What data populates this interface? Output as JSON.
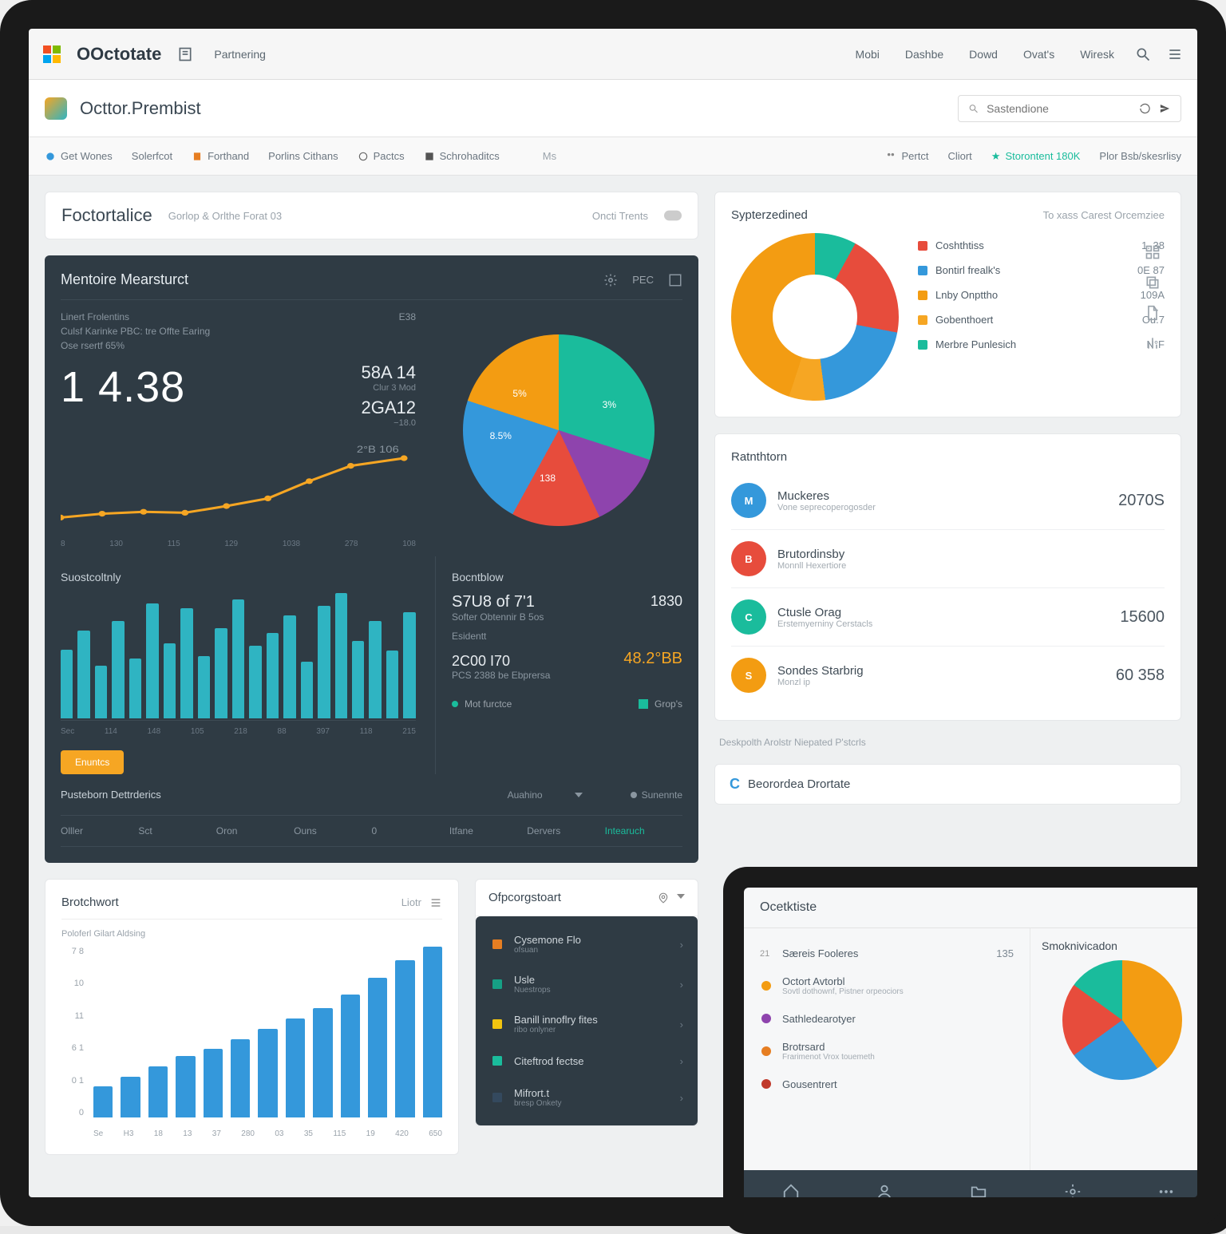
{
  "topbar": {
    "brand": "OOctotate",
    "tab1": "Partnering",
    "nav": [
      "Mobi",
      "Dashbe",
      "Dowd",
      "Ovat's",
      "Wiresk"
    ]
  },
  "subbar": {
    "title": "Octtor.Prembist",
    "search_placeholder": "Sastendione"
  },
  "toolbar": {
    "items": [
      "Get Wones",
      "Solerfcot",
      "Forthand",
      "Porlins Cithans",
      "Pactcs",
      "Schrohaditcs"
    ],
    "right": [
      "Pertct",
      "Cliort",
      "Storontent 180K",
      "Plor Bsb/skesrlisy"
    ]
  },
  "page": {
    "title": "Foctortalice",
    "subtitle": "Gorlop & Orlthe Forat 03",
    "link": "Oncti Trents"
  },
  "dark": {
    "title": "Mentoire Mearsturct",
    "tab_pec": "PEC",
    "sub1": "Linert Frolentins",
    "sub2": "Culsf Karinke PBC: tre Offte Earing",
    "sub3": "Ose rsertf 65%",
    "big": "1 4.38",
    "right_top_val": "E38",
    "stat1_v": "58A 14",
    "stat1_l": "Clur 3 Mod",
    "stat2_v": "2GA12",
    "stat2_l": "−18.0",
    "spark_x": [
      "8",
      "130",
      "115",
      "129",
      "1038",
      "278",
      "108"
    ],
    "spark_peak": "2°B 106",
    "section2": "Suostcoltnly",
    "bar_x": [
      "Sec",
      "114",
      "148",
      "105",
      "218",
      "88",
      "397",
      "118",
      "215"
    ],
    "col2_title": "Bocntblow",
    "col2_v1": "S7U8 of 7'1",
    "col2_v1s": "Softer Obtennir B 5os",
    "col2_v2": "Esidentt",
    "col2_v3": "2C00 I70",
    "col2_v3s": "PCS 2388 be Ebprersa",
    "col2_side_v": "1830",
    "col2_side_b": "48.2°BB",
    "pill": "Enuntcs",
    "legend1": "Mot furctce",
    "legend2": "Grop's",
    "tbl_title": "Pusteborn Dettrderics",
    "tbl_col2": "Auahino",
    "tbl_col3": "Sunennte",
    "tbl_cells": [
      "Olller",
      "Sct",
      "Oron",
      "Ouns",
      "0",
      "Itfane",
      "Dervers",
      "Intearuch"
    ]
  },
  "donut_card": {
    "title": "Sypterzedined",
    "right_title": "To xass Carest Orcemziee",
    "items": [
      {
        "label": "Coshthtiss",
        "val": "1. 38",
        "color": "#e74c3c"
      },
      {
        "label": "Bontirl frealk's",
        "val": "0E 87",
        "color": "#3498db"
      },
      {
        "label": "Lnby Onpttho",
        "val": "109A",
        "color": "#f39c12"
      },
      {
        "label": "Gobenthoert",
        "val": "Ou.7",
        "color": "#f6a623"
      },
      {
        "label": "Merbre Punlesich",
        "val": "N°F",
        "color": "#1abc9c"
      }
    ]
  },
  "stats": {
    "title": "Ratnthtorn",
    "items": [
      {
        "icon": "M",
        "label": "Muckeres",
        "sub": "Vone seprecoperogosder",
        "val": "2070S",
        "color": "#3498db"
      },
      {
        "icon": "B",
        "label": "Brutordinsby",
        "sub": "Monnll Hexertiore",
        "val": "",
        "color": "#e74c3c"
      },
      {
        "icon": "C",
        "label": "Ctusle Orag",
        "sub": "Erstemyerniny Cerstacls",
        "val": "15600",
        "color": "#1abc9c"
      },
      {
        "icon": "S",
        "label": "Sondes Starbrig",
        "sub": "Monzl ip",
        "val": "60 358",
        "color": "#f39c12"
      }
    ],
    "footer": "Deskpolth Arolstr Niepated P'stcrls"
  },
  "bottom_left": {
    "title": "Brotchwort",
    "tab": "Liotr",
    "sub": "Poloferl Gilart Aldsing",
    "y": [
      "7 8",
      "10",
      "11",
      "6 1",
      "0 1",
      "0"
    ],
    "x": [
      "Se",
      "H3",
      "18",
      "13",
      "37",
      "280",
      "03",
      "35",
      "115",
      "19",
      "420",
      "650"
    ]
  },
  "bottom_mid": {
    "title": "Ofpcorgstoart",
    "items": [
      {
        "label": "Cysemone Flo",
        "sub": "ofsuan",
        "color": "#e67e22"
      },
      {
        "label": "Usle",
        "sub": "Nuestrops",
        "color": "#16a085"
      },
      {
        "label": "Banill innoflry fites",
        "sub": "ribo onlyner",
        "color": "#f1c40f"
      },
      {
        "label": "Citeftrod fectse",
        "sub": "",
        "color": "#1abc9c"
      },
      {
        "label": "Mifrort.t",
        "sub": "bresp Onkety",
        "color": "#34495e"
      }
    ]
  },
  "section_c": {
    "title": "Beorordea Drortate"
  },
  "tablet": {
    "title": "Ocetktiste",
    "col2_title": "Smoknivicadon",
    "items": [
      {
        "label": "Særeis Fooleres",
        "sub": "",
        "val": "135",
        "color": "#d35400"
      },
      {
        "label": "Octort Avtorbl",
        "sub": "Sovtl dothownf, Pistner orpeociors",
        "val": "",
        "color": "#f39c12"
      },
      {
        "label": "Sathledearotyer",
        "sub": "",
        "val": "",
        "color": "#8e44ad"
      },
      {
        "label": "Brotrsard",
        "sub": "Frarimenot Vrox touemeth",
        "val": "",
        "color": "#e67e22"
      },
      {
        "label": "Gousentrert",
        "sub": "",
        "val": "",
        "color": "#c0392b"
      }
    ]
  },
  "chart_data": [
    {
      "type": "line",
      "name": "dark_sparkline",
      "x": [
        "8",
        "130",
        "115",
        "129",
        "1038",
        "278",
        "108"
      ],
      "values": [
        18,
        22,
        24,
        23,
        30,
        38,
        56,
        72,
        80
      ],
      "ylim": [
        0,
        100
      ],
      "color": "#f6a623",
      "peak_label": "2°B 106"
    },
    {
      "type": "pie",
      "name": "dark_pie",
      "slices": [
        {
          "label": "3%",
          "value": 30,
          "color": "#1abc9c"
        },
        {
          "label": "5%",
          "value": 13,
          "color": "#8e44ad"
        },
        {
          "label": "8.5%",
          "value": 15,
          "color": "#e74c3c"
        },
        {
          "label": "138",
          "value": 22,
          "color": "#3498db"
        },
        {
          "label": "",
          "value": 20,
          "color": "#f39c12"
        }
      ]
    },
    {
      "type": "bar",
      "name": "dark_bars",
      "categories": [
        "Sec",
        "114",
        "148",
        "105",
        "218",
        "88",
        "397",
        "118",
        "215"
      ],
      "values": [
        55,
        70,
        42,
        78,
        48,
        92,
        60,
        88,
        50,
        72,
        95,
        58,
        68,
        82,
        45,
        90,
        100,
        62,
        78,
        54,
        85
      ],
      "color": "#2fb4c2",
      "ylim": [
        0,
        100
      ]
    },
    {
      "type": "pie",
      "name": "donut_right",
      "title": "Sypterzedined",
      "slices": [
        {
          "label": "Coshthtiss",
          "value": 20,
          "color": "#e74c3c"
        },
        {
          "label": "Bontirl frealk's",
          "value": 20,
          "color": "#3498db"
        },
        {
          "label": "Lnby Onpttho",
          "value": 45,
          "color": "#f39c12"
        },
        {
          "label": "Gobenthoert",
          "value": 5,
          "color": "#f6a623"
        },
        {
          "label": "Merbre Punlesich",
          "value": 10,
          "color": "#1abc9c"
        }
      ],
      "donut": true
    },
    {
      "type": "bar",
      "name": "bottom_growth",
      "title": "Brotchwort",
      "categories": [
        "Se",
        "H3",
        "18",
        "13",
        "37",
        "280",
        "03",
        "35",
        "115",
        "19",
        "420",
        "650"
      ],
      "values": [
        18,
        24,
        30,
        36,
        40,
        46,
        52,
        58,
        64,
        72,
        82,
        92,
        100
      ],
      "ylim": [
        0,
        100
      ],
      "ylabels": [
        "7 8",
        "10",
        "11",
        "6 1",
        "0 1",
        "0"
      ],
      "color": "#3498db"
    },
    {
      "type": "pie",
      "name": "tablet_donut",
      "slices": [
        {
          "value": 40,
          "color": "#f39c12"
        },
        {
          "value": 25,
          "color": "#3498db"
        },
        {
          "value": 20,
          "color": "#e74c3c"
        },
        {
          "value": 15,
          "color": "#1abc9c"
        }
      ],
      "donut": true
    }
  ]
}
